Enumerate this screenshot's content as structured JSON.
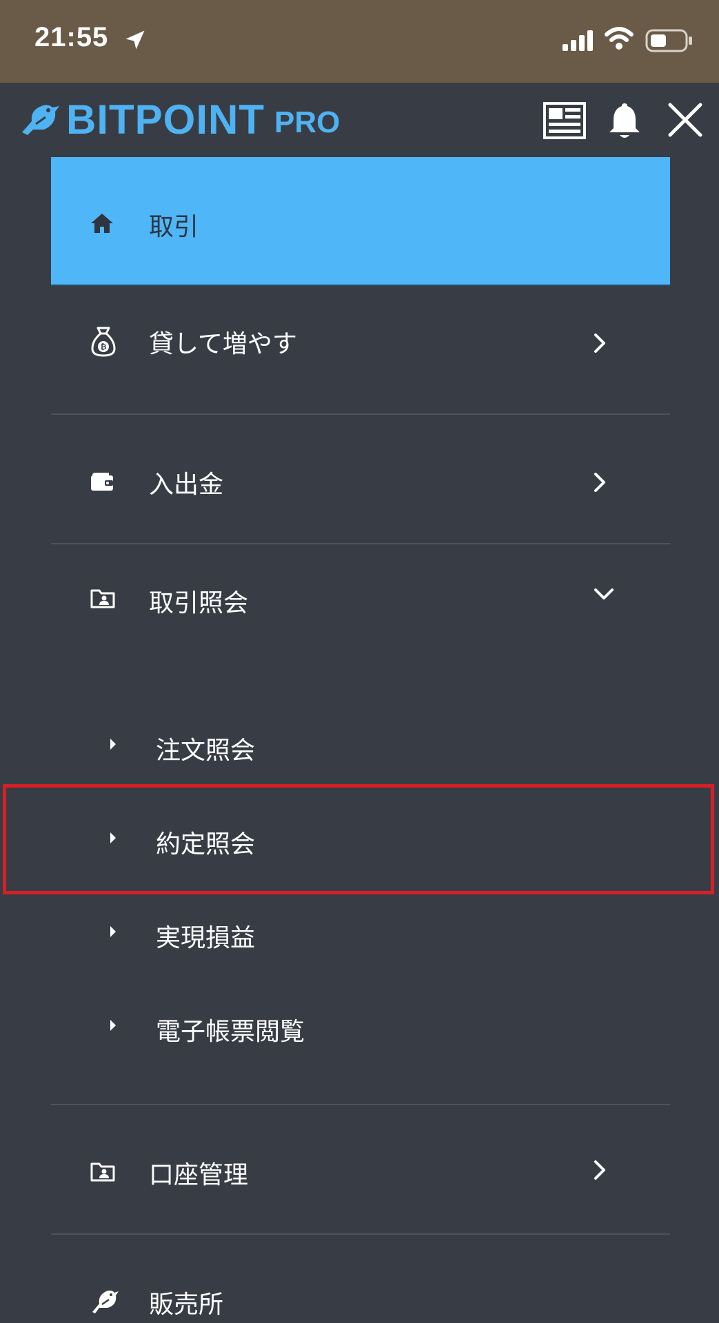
{
  "status_bar": {
    "time": "21:55",
    "icons": [
      "location-arrow-icon",
      "cellular-signal-icon",
      "wifi-icon",
      "battery-icon"
    ]
  },
  "header": {
    "logo_text": "BITPOINT",
    "logo_suffix": "PRO",
    "icons": [
      "news-icon",
      "bell-icon",
      "close-icon"
    ]
  },
  "menu": {
    "items": [
      {
        "label": "取引",
        "icon": "home-icon",
        "active": true
      },
      {
        "label": "貸して増やす",
        "icon": "money-bag-icon",
        "chevron": "right"
      },
      {
        "label": "入出金",
        "icon": "wallet-icon",
        "chevron": "right"
      },
      {
        "label": "取引照会",
        "icon": "folder-user-icon",
        "chevron": "down"
      },
      {
        "label": "口座管理",
        "icon": "folder-user-icon",
        "chevron": "right"
      },
      {
        "label": "販売所",
        "icon": "bird-icon"
      }
    ],
    "sub_items": [
      {
        "label": "注文照会"
      },
      {
        "label": "約定照会",
        "highlighted": true
      },
      {
        "label": "実現損益"
      },
      {
        "label": "電子帳票閲覧"
      }
    ]
  },
  "colors": {
    "background": "#383d45",
    "status_bar": "#6a5b48",
    "accent": "#4fb6f8",
    "highlight_border": "#d81e26"
  }
}
